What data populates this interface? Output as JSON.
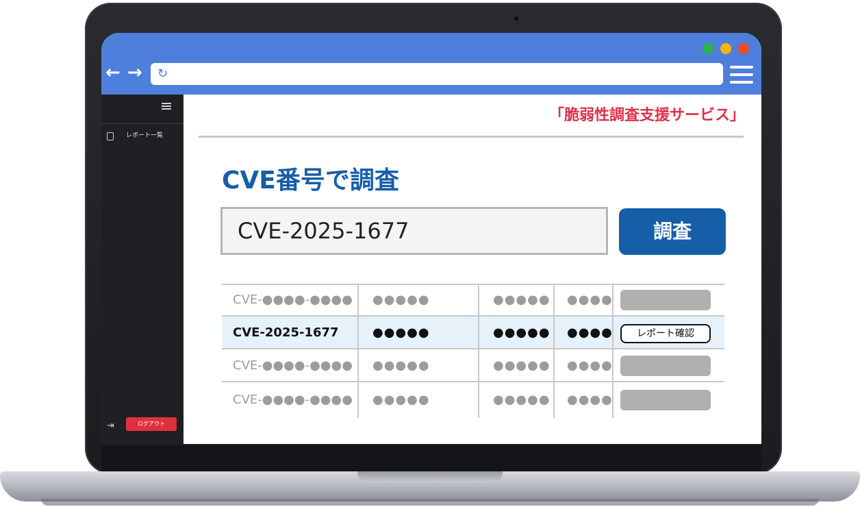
{
  "header": {
    "service_title": "「脆弱性調査支援サービス」"
  },
  "sidebar": {
    "items": [
      {
        "label": "レポート一覧",
        "icon": "document-icon"
      }
    ],
    "logout_label": "ログアウト"
  },
  "main": {
    "section_title": "CVE番号で調査",
    "search": {
      "value": "CVE-2025-1677",
      "button_label": "調査"
    },
    "results": [
      {
        "cve": "CVE-●●●●-●●●●",
        "col2": "●●●●●",
        "col3": "●●●●●",
        "col4": "●●●●",
        "selected": false
      },
      {
        "cve": "CVE-2025-1677",
        "col2": "●●●●●",
        "col3": "●●●●●",
        "col4": "●●●●",
        "selected": true,
        "action_label": "レポート確認"
      },
      {
        "cve": "CVE-●●●●-●●●●",
        "col2": "●●●●●",
        "col3": "●●●●●",
        "col4": "●●●●",
        "selected": false
      },
      {
        "cve": "CVE-●●●●-●●●●",
        "col2": "●●●●●",
        "col3": "●●●●●",
        "col4": "●●●●",
        "selected": false
      }
    ]
  },
  "colors": {
    "browser_bar": "#4f7fdc",
    "accent_blue": "#175ea9",
    "service_title": "#e0304a",
    "logout": "#e0303d",
    "selected_row": "#e6f1fa"
  }
}
